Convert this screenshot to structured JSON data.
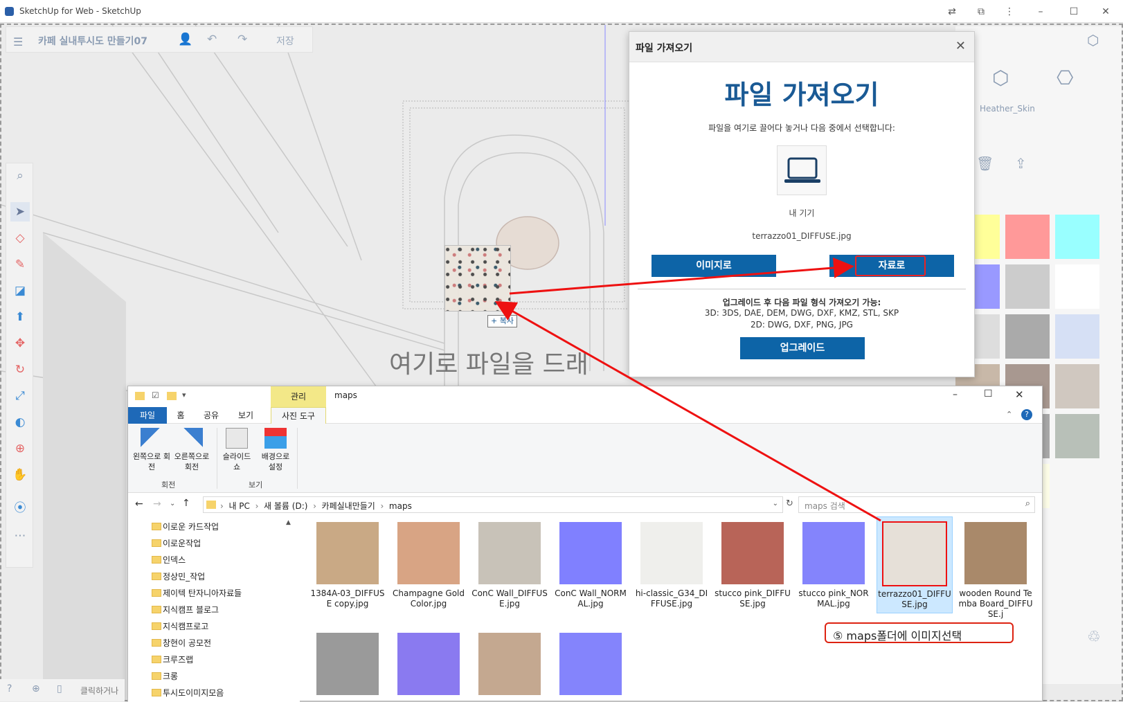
{
  "browser": {
    "title": "SketchUp for Web - SketchUp",
    "buttons": [
      "translate-icon",
      "extensions-icon",
      "more-icon",
      "minimize-icon",
      "maximize-icon",
      "close-icon"
    ]
  },
  "sketchup": {
    "project_name": "카페 실내투시도 만들기07",
    "save_label": "저장",
    "drop_hint": "여기로 파일을 드래",
    "tools": [
      "search-icon",
      "select-icon",
      "eraser-icon",
      "pencil-icon",
      "rectangle-icon",
      "pushpull-icon",
      "move-icon",
      "rotate-icon",
      "scale-icon",
      "paint-icon",
      "orbit-icon",
      "pan-icon",
      "tape-icon",
      "more-dots-icon"
    ],
    "status_hint": "클릭하거나"
  },
  "right_panel": {
    "material_name": "Heather_Skin",
    "swatch_colors": [
      "#ffff99",
      "#ff9999",
      "#99ffff",
      "#9999ff",
      "#cccccc",
      "#ffffff",
      "#dddddd",
      "#aaaaaa",
      "#d6e0f5",
      "#c8b8a8",
      "#a89890",
      "#d0c8c0",
      "#c8c0b0",
      "#a8a8a8",
      "#b8c0b8",
      "#b8b0a8",
      "#fdfde8"
    ]
  },
  "dialog": {
    "header": "파일 가져오기",
    "title": "파일 가져오기",
    "instruction": "파일을 여기로 끌어다 놓거나 다음 중에서 선택합니다:",
    "device_label": "내 기기",
    "filename": "terrazzo01_DIFFUSE.jpg",
    "btn_image": "이미지로",
    "btn_material": "자료로",
    "upgrade_text": "업그레이드 후 다음 파일 형식 가져오기 가능:",
    "formats_3d": "3D:  3DS, DAE, DEM, DWG, DXF, KMZ, STL, SKP",
    "formats_2d": "2D:  DWG, DXF, PNG, JPG",
    "btn_upgrade": "업그레이드"
  },
  "drag": {
    "copy_label": "+ 복사"
  },
  "explorer": {
    "context_tab": "관리",
    "window_title": "maps",
    "tabs": [
      "파일",
      "홈",
      "공유",
      "보기",
      "사진 도구"
    ],
    "ribbon": {
      "rotate_left": "왼쪽으로 회전",
      "rotate_right": "오른쪽으로 회전",
      "group_rotate": "회전",
      "slideshow": "슬라이드 쇼",
      "set_background": "배경으로 설정",
      "group_view": "보기"
    },
    "breadcrumb": [
      "내 PC",
      "새 볼륨 (D:)",
      "카페실내만들기",
      "maps"
    ],
    "search_placeholder": "maps 검색",
    "nav_items": [
      "이로운 카드작업",
      "이로운작업",
      "인덱스",
      "정상민_작업",
      "제이텍 탄자니아자료들",
      "지식캠프 블로그",
      "지식캠프로고",
      "창현이 공모전",
      "크루즈랩",
      "크롱",
      "투시도이미지모음"
    ],
    "files": [
      {
        "name": "1384A-03_DIFFUSE copy.jpg",
        "color": "#c9a985"
      },
      {
        "name": "Champagne Gold Color.jpg",
        "color": "#d8a484"
      },
      {
        "name": "ConC Wall_DIFFUSE.jpg",
        "color": "#c8c2b8"
      },
      {
        "name": "ConC Wall_NORMAL.jpg",
        "color": "#8080ff"
      },
      {
        "name": "hi-classic_G34_DIFFUSE.jpg",
        "color": "#efefec"
      },
      {
        "name": "stucco pink_DIFFUSE.jpg",
        "color": "#b86458"
      },
      {
        "name": "stucco pink_NORMAL.jpg",
        "color": "#8484fc"
      },
      {
        "name": "terrazzo01_DIFFUSE.jpg",
        "color": "#e6e0d8",
        "selected": true
      },
      {
        "name": "wooden Round Temba Board_DIFFUSE.j",
        "color": "#a9896a"
      }
    ],
    "files_row2": [
      {
        "name": "",
        "color": "#9a9a9a"
      },
      {
        "name": "",
        "color": "#8a7af0"
      },
      {
        "name": "",
        "color": "#c4a890"
      },
      {
        "name": "",
        "color": "#8484fc"
      }
    ]
  },
  "callout": {
    "text": "⑤  maps폴더에 이미지선택"
  }
}
